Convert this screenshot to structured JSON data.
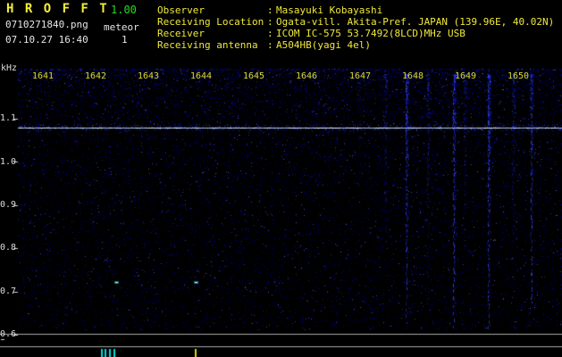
{
  "app": {
    "title": "H R O F F T",
    "version": "1.00",
    "filename": "0710271840.png",
    "mode_label": "meteor",
    "meteor_count": "1",
    "datetime": "07.10.27 16:40"
  },
  "info": {
    "rows": [
      {
        "label": "Observer",
        "sep": ":",
        "value": "Masayuki Kobayashi"
      },
      {
        "label": "Receiving Location",
        "sep": ":",
        "value": "Ogata-vill. Akita-Pref. JAPAN (139.96E, 40.02N)"
      },
      {
        "label": "Receiver",
        "sep": ":",
        "value": "ICOM IC-575 53.7492(8LCD)MHz USB"
      },
      {
        "label": "Receiving antenna",
        "sep": ":",
        "value": "A504HB(yagi 4el)"
      }
    ]
  },
  "chart_data": {
    "type": "heatmap",
    "description": "radio meteor observation spectrogram, blue noise field on black",
    "x_tick_labels": [
      "1641",
      "1642",
      "1643",
      "1644",
      "1645",
      "1646",
      "1647",
      "1648",
      "1649",
      "1650"
    ],
    "y_unit_label": "kHz",
    "y_tick_labels": [
      "1.1",
      "1.0",
      "0.9",
      "0.8",
      "0.7",
      "0.6"
    ],
    "y_range_khz": [
      0.58,
      1.17
    ],
    "carrier_line_khz": 1.08,
    "interference_streaks": [
      {
        "t": 1647.0,
        "strength": 0.28,
        "extent": 0.5
      },
      {
        "t": 1647.5,
        "strength": 0.5,
        "extent": 0.8
      },
      {
        "t": 1647.9,
        "strength": 0.88,
        "extent": 1.0
      },
      {
        "t": 1648.3,
        "strength": 0.62,
        "extent": 0.92
      },
      {
        "t": 1648.8,
        "strength": 0.9,
        "extent": 1.0
      },
      {
        "t": 1649.0,
        "strength": 0.5,
        "extent": 0.75
      },
      {
        "t": 1649.45,
        "strength": 0.95,
        "extent": 1.0
      },
      {
        "t": 1649.92,
        "strength": 0.6,
        "extent": 0.85
      },
      {
        "t": 1650.26,
        "strength": 0.7,
        "extent": 0.9
      }
    ],
    "echo_dots": [
      {
        "t": 1642.4,
        "khz": 0.72
      },
      {
        "t": 1643.9,
        "khz": 0.72
      }
    ],
    "detection_ticks": [
      {
        "t": 1642.1,
        "color": "cyan"
      },
      {
        "t": 1642.18,
        "color": "cyan"
      },
      {
        "t": 1642.26,
        "color": "cyan"
      },
      {
        "t": 1642.34,
        "color": "cyan"
      },
      {
        "t": 1643.88,
        "color": "yellow"
      }
    ]
  },
  "colors": {
    "background": "#000000",
    "header_yellow": "#efe83a",
    "header_white": "#e6e6e6",
    "version_green": "#22dd22",
    "time_label_yellow": "#dddd33",
    "freq_label_white": "#dcdcdc",
    "noise_blue": "#0000cc",
    "carrier_line": "#bdd7fa",
    "echo_cyan": "#00ffff",
    "tick_cyan": "#00d9d9",
    "tick_yellow": "#d9d900"
  }
}
